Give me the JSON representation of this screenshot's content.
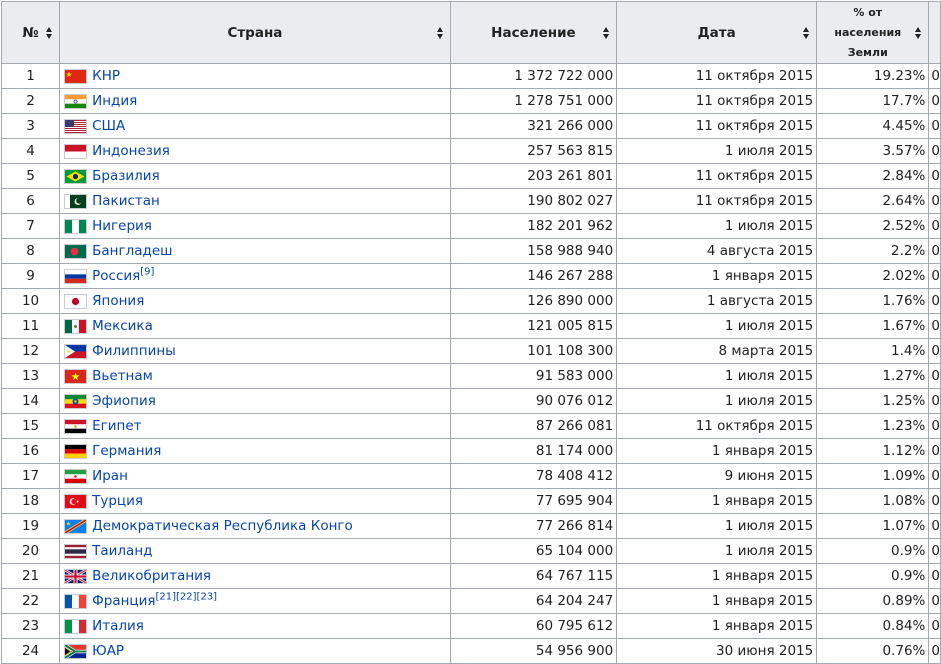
{
  "table": {
    "headers": {
      "num": "№",
      "country": "Страна",
      "population": "Население",
      "date": "Дата",
      "percent_lines": [
        "% от",
        "населения",
        "Земли"
      ]
    },
    "rows": [
      {
        "num": "1",
        "country": "КНР",
        "flag": "china-flag-icon",
        "population": "1 372 722 000",
        "date": "11 октября 2015",
        "percent": "19.23%",
        "extra": "0",
        "ref": ""
      },
      {
        "num": "2",
        "country": "Индия",
        "flag": "india-flag-icon",
        "population": "1 278 751 000",
        "date": "11 октября 2015",
        "percent": "17.7%",
        "extra": "0",
        "ref": ""
      },
      {
        "num": "3",
        "country": "США",
        "flag": "usa-flag-icon",
        "population": "321 266 000",
        "date": "11 октября 2015",
        "percent": "4.45%",
        "extra": "0",
        "ref": ""
      },
      {
        "num": "4",
        "country": "Индонезия",
        "flag": "indonesia-flag-icon",
        "population": "257 563 815",
        "date": "1 июля 2015",
        "percent": "3.57%",
        "extra": "0",
        "ref": ""
      },
      {
        "num": "5",
        "country": "Бразилия",
        "flag": "brazil-flag-icon",
        "population": "203 261 801",
        "date": "11 октября 2015",
        "percent": "2.84%",
        "extra": "0",
        "ref": ""
      },
      {
        "num": "6",
        "country": "Пакистан",
        "flag": "pakistan-flag-icon",
        "population": "190 802 027",
        "date": "11 октября 2015",
        "percent": "2.64%",
        "extra": "0",
        "ref": ""
      },
      {
        "num": "7",
        "country": "Нигерия",
        "flag": "nigeria-flag-icon",
        "population": "182 201 962",
        "date": "1 июля 2015",
        "percent": "2.52%",
        "extra": "0",
        "ref": ""
      },
      {
        "num": "8",
        "country": "Бангладеш",
        "flag": "bangladesh-flag-icon",
        "population": "158 988 940",
        "date": "4 августа 2015",
        "percent": "2.2%",
        "extra": "0",
        "ref": ""
      },
      {
        "num": "9",
        "country": "Россия",
        "flag": "russia-flag-icon",
        "population": "146 267 288",
        "date": "1 января 2015",
        "percent": "2.02%",
        "extra": "0",
        "ref": "[9]"
      },
      {
        "num": "10",
        "country": "Япония",
        "flag": "japan-flag-icon",
        "population": "126 890 000",
        "date": "1 августа 2015",
        "percent": "1.76%",
        "extra": "0",
        "ref": ""
      },
      {
        "num": "11",
        "country": "Мексика",
        "flag": "mexico-flag-icon",
        "population": "121 005 815",
        "date": "1 июля 2015",
        "percent": "1.67%",
        "extra": "0",
        "ref": ""
      },
      {
        "num": "12",
        "country": "Филиппины",
        "flag": "philippines-flag-icon",
        "population": "101 108 300",
        "date": "8 марта 2015",
        "percent": "1.4%",
        "extra": "0",
        "ref": ""
      },
      {
        "num": "13",
        "country": "Вьетнам",
        "flag": "vietnam-flag-icon",
        "population": "91 583 000",
        "date": "1 июля 2015",
        "percent": "1.27%",
        "extra": "0",
        "ref": ""
      },
      {
        "num": "14",
        "country": "Эфиопия",
        "flag": "ethiopia-flag-icon",
        "population": "90 076 012",
        "date": "1 июля 2015",
        "percent": "1.25%",
        "extra": "0",
        "ref": ""
      },
      {
        "num": "15",
        "country": "Египет",
        "flag": "egypt-flag-icon",
        "population": "87 266 081",
        "date": "11 октября 2015",
        "percent": "1.23%",
        "extra": "0",
        "ref": ""
      },
      {
        "num": "16",
        "country": "Германия",
        "flag": "germany-flag-icon",
        "population": "81 174 000",
        "date": "1 января 2015",
        "percent": "1.12%",
        "extra": "0",
        "ref": ""
      },
      {
        "num": "17",
        "country": "Иран",
        "flag": "iran-flag-icon",
        "population": "78 408 412",
        "date": "9 июня 2015",
        "percent": "1.09%",
        "extra": "0",
        "ref": ""
      },
      {
        "num": "18",
        "country": "Турция",
        "flag": "turkey-flag-icon",
        "population": "77 695 904",
        "date": "1 января 2015",
        "percent": "1.08%",
        "extra": "0",
        "ref": ""
      },
      {
        "num": "19",
        "country": "Демократическая Республика Конго",
        "flag": "drc-flag-icon",
        "population": "77 266 814",
        "date": "1 июля 2015",
        "percent": "1.07%",
        "extra": "0",
        "ref": ""
      },
      {
        "num": "20",
        "country": "Таиланд",
        "flag": "thailand-flag-icon",
        "population": "65 104 000",
        "date": "1 июля 2015",
        "percent": "0.9%",
        "extra": "0",
        "ref": ""
      },
      {
        "num": "21",
        "country": "Великобритания",
        "flag": "uk-flag-icon",
        "population": "64 767 115",
        "date": "1 января 2015",
        "percent": "0.9%",
        "extra": "0",
        "ref": ""
      },
      {
        "num": "22",
        "country": "Франция",
        "flag": "france-flag-icon",
        "population": "64 204 247",
        "date": "1 января 2015",
        "percent": "0.89%",
        "extra": "0",
        "ref": "[21][22][23]"
      },
      {
        "num": "23",
        "country": "Италия",
        "flag": "italy-flag-icon",
        "population": "60 795 612",
        "date": "1 января 2015",
        "percent": "0.84%",
        "extra": "0",
        "ref": ""
      },
      {
        "num": "24",
        "country": "ЮАР",
        "flag": "south-africa-flag-icon",
        "population": "54 956 900",
        "date": "30 июня 2015",
        "percent": "0.76%",
        "extra": "0",
        "ref": ""
      }
    ]
  },
  "colors": {
    "link": "#0645ad",
    "header_bg": "#eaecf0",
    "border": "#a2a9b1"
  }
}
